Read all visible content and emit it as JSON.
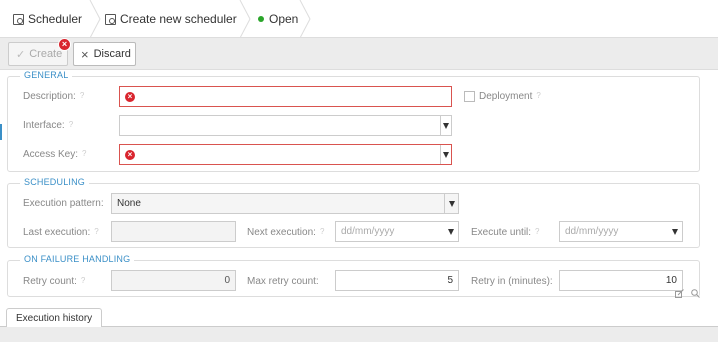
{
  "tabs": [
    {
      "label": "Scheduler"
    },
    {
      "label": "Create new scheduler"
    },
    {
      "label": "Open",
      "status_color": "#2aa52a"
    }
  ],
  "toolbar": {
    "create_label": "Create",
    "discard_label": "Discard"
  },
  "general": {
    "legend": "GENERAL",
    "description_label": "Description:",
    "interface_label": "Interface:",
    "access_key_label": "Access Key:",
    "deployment_label": "Deployment"
  },
  "scheduling": {
    "legend": "SCHEDULING",
    "execution_pattern_label": "Execution pattern:",
    "execution_pattern_value": "None",
    "last_execution_label": "Last execution:",
    "next_execution_label": "Next execution:",
    "next_execution_placeholder": "dd/mm/yyyy",
    "execute_until_label": "Execute until:",
    "execute_until_placeholder": "dd/mm/yyyy"
  },
  "failure": {
    "legend": "ON FAILURE HANDLING",
    "retry_count_label": "Retry count:",
    "retry_count_value": "0",
    "max_retry_label": "Max retry count:",
    "max_retry_value": "5",
    "retry_in_label": "Retry in (minutes):",
    "retry_in_value": "10"
  },
  "bottom": {
    "tab_label": "Execution history"
  },
  "colors": {
    "accent": "#3a8fc7",
    "error": "#d9252e",
    "status_ok": "#2aa52a"
  }
}
